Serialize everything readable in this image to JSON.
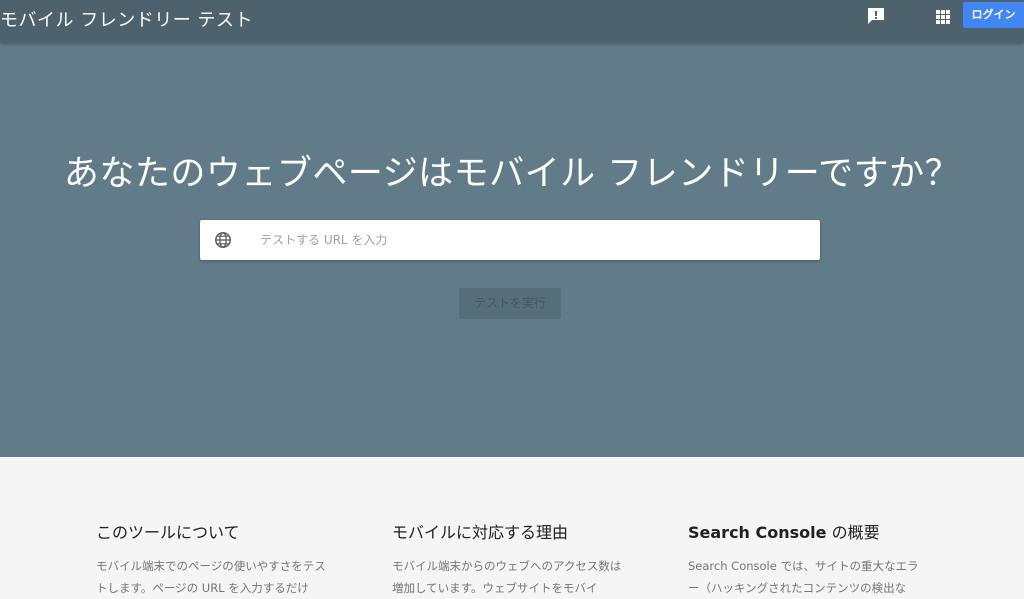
{
  "header": {
    "app_title": "モバイル フレンドリー テスト",
    "feedback_icon": "feedback-icon",
    "apps_icon": "apps-grid-icon",
    "login_label": "ログイン",
    "colors": {
      "bar": "#4d626c",
      "login_button": "#4285f4"
    }
  },
  "hero": {
    "headline": "あなたのウェブページはモバイル フレンドリーですか？",
    "search": {
      "icon": "globe-icon",
      "placeholder": "テストする URL を入力",
      "value": ""
    },
    "run_test_label": "テストを実行",
    "colors": {
      "background": "#617c88"
    }
  },
  "info": {
    "columns": [
      {
        "title": "このツールについて",
        "text": "モバイル端末でのページの使いやすさをテストします。ページの URL を入力するだけ"
      },
      {
        "title": "モバイルに対応する理由",
        "text": "モバイル端末からのウェブへのアクセス数は増加しています。ウェブサイトをモバイ"
      },
      {
        "title_bold": "Search Console",
        "title_rest": " の概要",
        "text": "Search Console では、サイトの重大なエラー（ハッキングされたコンテンツの検出な"
      }
    ]
  }
}
